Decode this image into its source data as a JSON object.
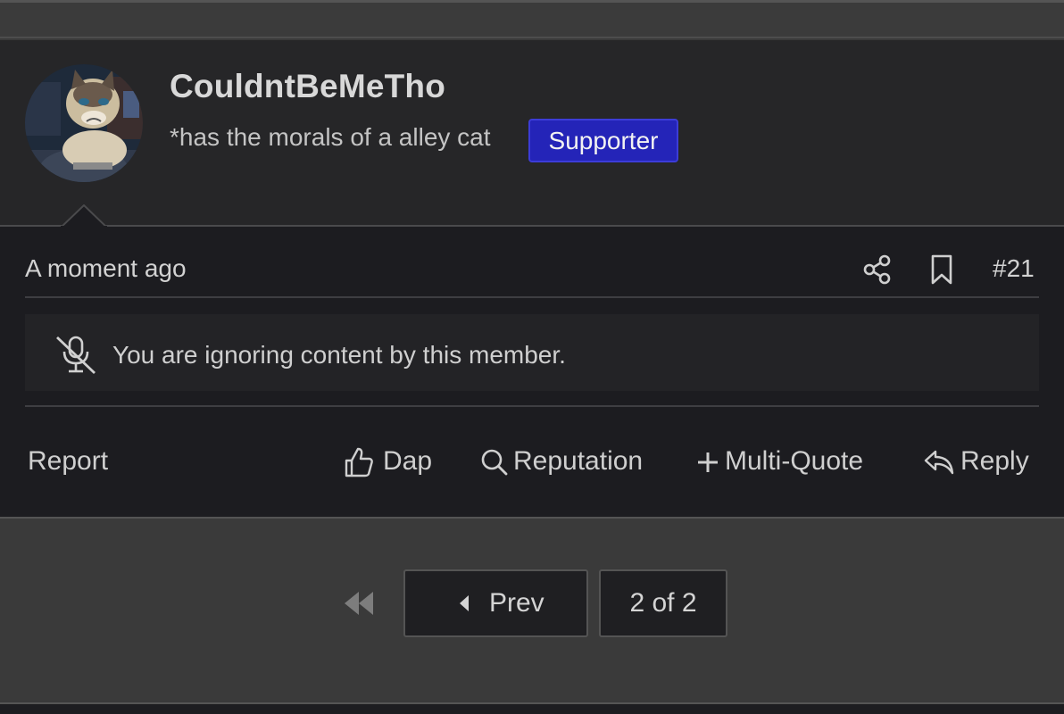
{
  "user": {
    "username": "CouldntBeMeTho",
    "title": "*has the morals of a alley cat",
    "badge": "Supporter",
    "avatar": "grumpy-cat-avatar"
  },
  "post": {
    "timestamp": "A moment ago",
    "number": "#21",
    "ignored_message": "You are ignoring content by this member."
  },
  "actions": {
    "report": "Report",
    "dap": "Dap",
    "reputation": "Reputation",
    "multiquote": "Multi-Quote",
    "reply": "Reply"
  },
  "pagination": {
    "prev": "Prev",
    "page": "2 of 2"
  },
  "colors": {
    "badge_bg": "#2424b8",
    "post_bg": "#1c1c20",
    "header_bg": "#262628",
    "page_bg": "#3a3a3a"
  }
}
